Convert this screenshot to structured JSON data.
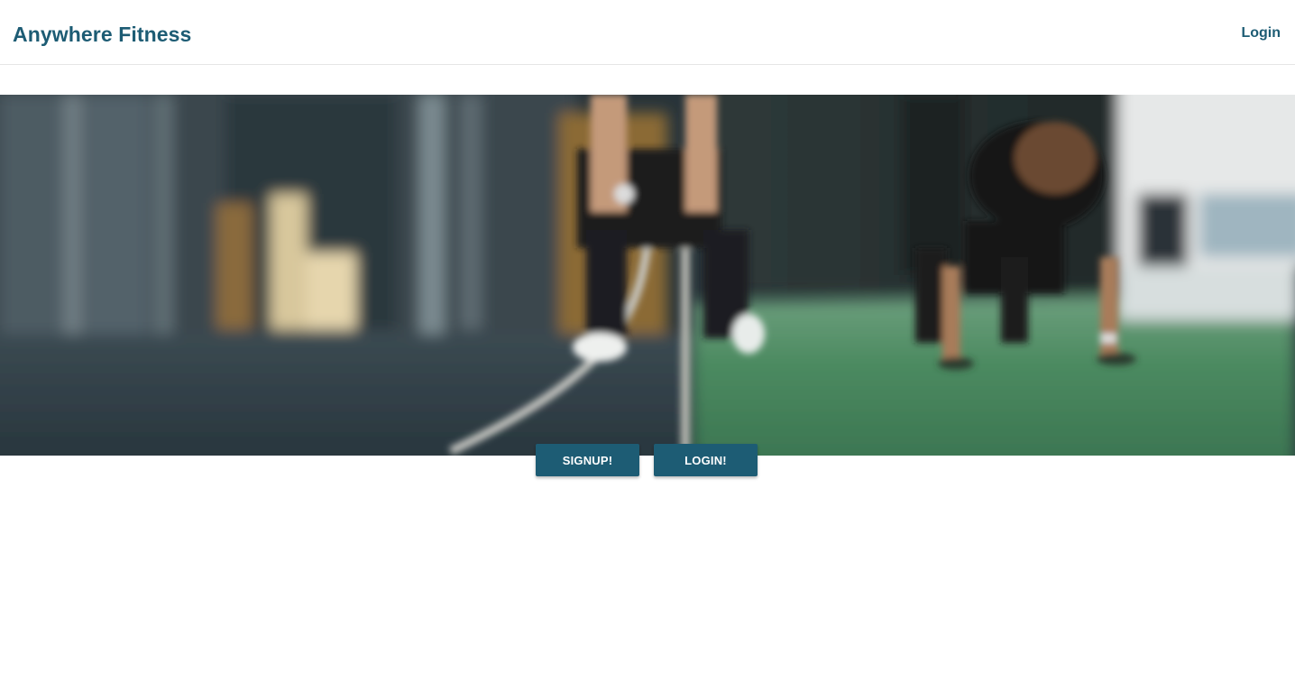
{
  "header": {
    "brand": "Anywhere Fitness",
    "login_link": "Login"
  },
  "hero": {
    "image_description": "gym-photo"
  },
  "actions": {
    "signup_label": "SIGNUP!",
    "login_label": "LOGIN!"
  },
  "colors": {
    "brand": "#1d5c74",
    "button_bg": "#1d5c74",
    "button_text": "#ffffff",
    "turf": "#3f7a55"
  }
}
